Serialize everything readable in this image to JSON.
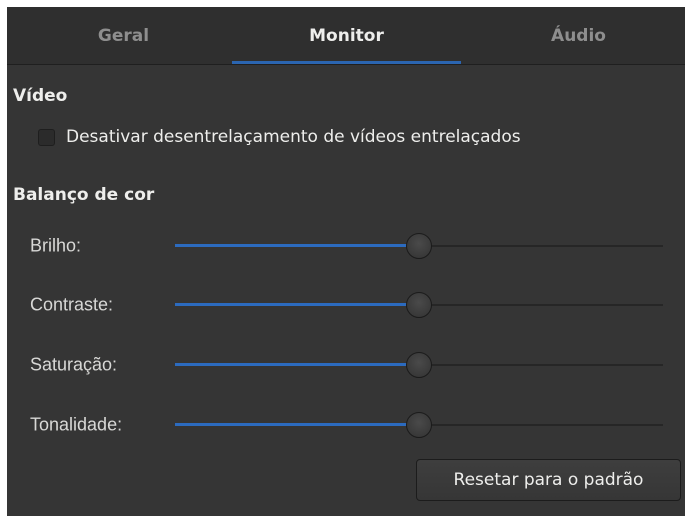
{
  "tabs": [
    {
      "label": "Geral",
      "active": false
    },
    {
      "label": "Monitor",
      "active": true
    },
    {
      "label": "Áudio",
      "active": false
    }
  ],
  "video": {
    "title": "Vídeo",
    "deinterlace_label": "Desativar desentrelaçamento de vídeos entrelaçados",
    "deinterlace_checked": false
  },
  "color_balance": {
    "title": "Balanço de cor",
    "sliders": [
      {
        "label": "Brilho:",
        "value": 0.5
      },
      {
        "label": "Contraste:",
        "value": 0.5
      },
      {
        "label": "Saturação:",
        "value": 0.5
      },
      {
        "label": "Tonalidade:",
        "value": 0.5
      }
    ]
  },
  "reset_label": "Resetar para o padrão",
  "colors": {
    "accent": "#2b65b0",
    "background": "#353535",
    "text": "#eeeeec"
  }
}
